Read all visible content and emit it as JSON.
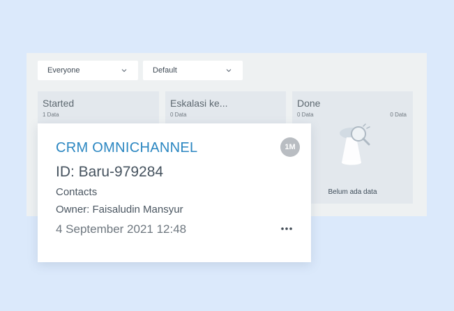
{
  "filters": {
    "owner_filter": "Everyone",
    "sort_filter": "Default"
  },
  "columns": [
    {
      "title": "Started",
      "count": "1 Data"
    },
    {
      "title": "Eskalasi ke...",
      "count": "0 Data"
    },
    {
      "title": "Done",
      "count": "0 Data",
      "count_right": "0 Data",
      "empty_text": "Belum ada data"
    }
  ],
  "card": {
    "brand": "CRM OMNICHANNEL",
    "badge": "1M",
    "id_text": "ID: Baru-979284",
    "type": "Contacts",
    "owner": "Owner: Faisaludin Mansyur",
    "date": "4 September 2021 12:48",
    "more_icon": "more-horizontal-icon"
  },
  "colors": {
    "background": "#dbe9fb",
    "board": "#eef1f2",
    "column": "#e3e8ed",
    "brand": "#2a86c1",
    "badge": "#b9bdc2"
  }
}
